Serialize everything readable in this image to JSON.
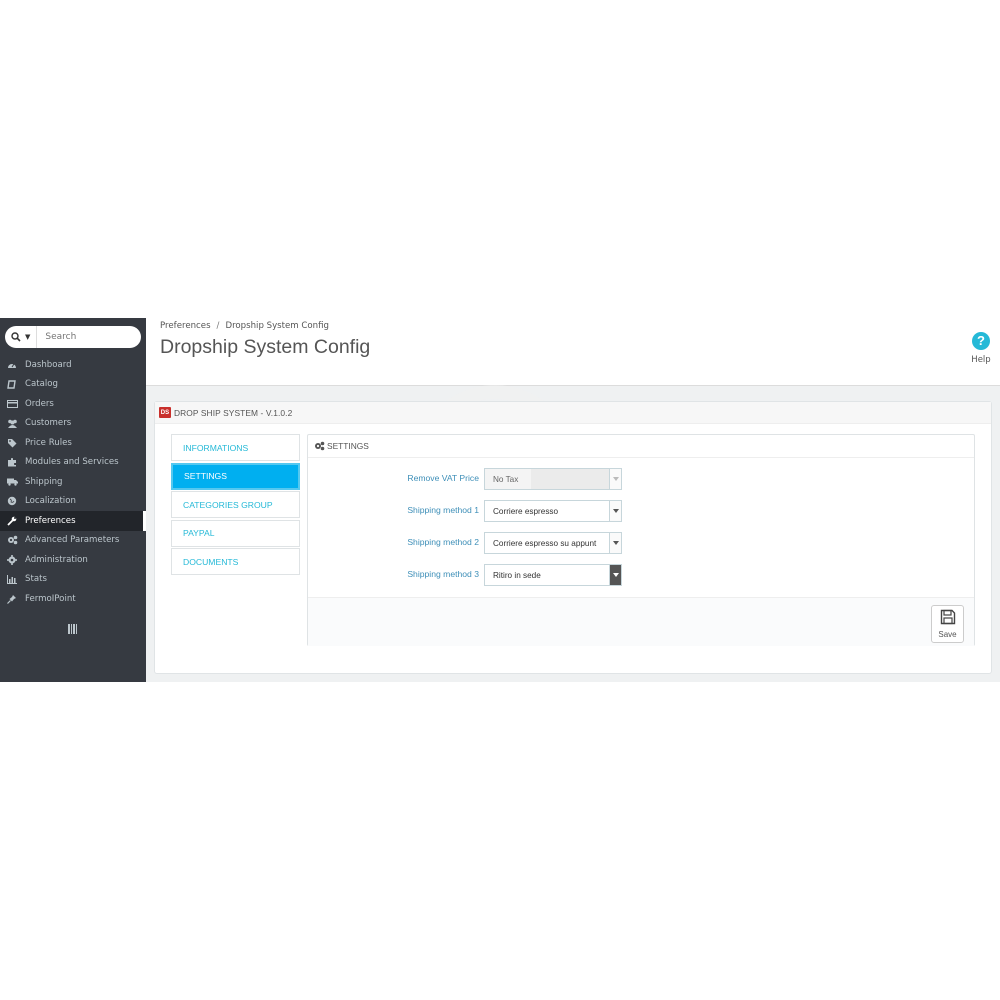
{
  "sidebar": {
    "search": {
      "placeholder": "Search"
    },
    "items": [
      {
        "label": "Dashboard",
        "icon": "dashboard-icon"
      },
      {
        "label": "Catalog",
        "icon": "book-icon"
      },
      {
        "label": "Orders",
        "icon": "credit-card-icon"
      },
      {
        "label": "Customers",
        "icon": "users-icon"
      },
      {
        "label": "Price Rules",
        "icon": "tags-icon"
      },
      {
        "label": "Modules and Services",
        "icon": "puzzle-icon"
      },
      {
        "label": "Shipping",
        "icon": "truck-icon"
      },
      {
        "label": "Localization",
        "icon": "globe-icon"
      },
      {
        "label": "Preferences",
        "icon": "wrench-icon",
        "active": true
      },
      {
        "label": "Advanced Parameters",
        "icon": "cogs-icon"
      },
      {
        "label": "Administration",
        "icon": "cog-icon"
      },
      {
        "label": "Stats",
        "icon": "bar-chart-icon"
      },
      {
        "label": "FermoIPoint",
        "icon": "pin-icon"
      }
    ]
  },
  "header": {
    "breadcrumb": [
      "Preferences",
      "Dropship System Config"
    ],
    "title": "Dropship System Config",
    "help_label": "Help",
    "help_symbol": "?"
  },
  "panel": {
    "logo_text": "DS",
    "heading": "DROP SHIP SYSTEM - V.1.0.2"
  },
  "tabs": [
    {
      "label": "INFORMATIONS",
      "active": false
    },
    {
      "label": "SETTINGS",
      "active": true
    },
    {
      "label": "CATEGORIES GROUP",
      "active": false
    },
    {
      "label": "PAYPAL",
      "active": false
    },
    {
      "label": "DOCUMENTS",
      "active": false
    }
  ],
  "settings": {
    "heading": "SETTINGS",
    "fields": [
      {
        "label": "Remove VAT Price",
        "value": "No Tax",
        "disabled": true
      },
      {
        "label": "Shipping method 1",
        "value": "Corriere espresso",
        "disabled": false
      },
      {
        "label": "Shipping method 2",
        "value": "Corriere espresso su appunt",
        "disabled": false
      },
      {
        "label": "Shipping method 3",
        "value": "Ritiro in sede",
        "disabled": false
      }
    ],
    "save_label": "Save"
  },
  "colors": {
    "sidebar_bg": "#363a41",
    "accent": "#25b9d7",
    "active_tab": "#00aff0",
    "logo_red": "#c9302c"
  }
}
